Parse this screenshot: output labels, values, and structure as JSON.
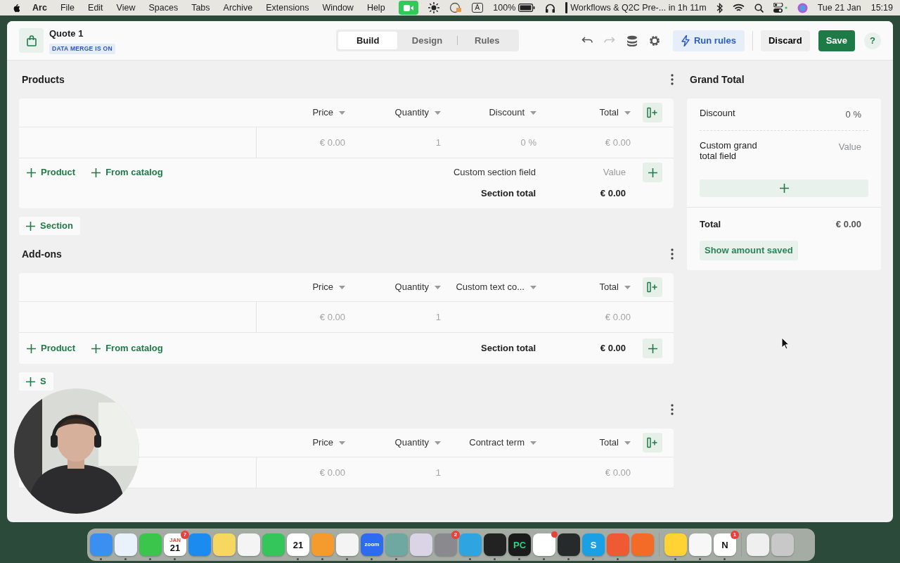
{
  "menu_bar": {
    "app": "Arc",
    "menus": [
      "File",
      "Edit",
      "View",
      "Spaces",
      "Tabs",
      "Archive",
      "Extensions",
      "Window",
      "Help"
    ],
    "input_source": "A",
    "battery": "100%",
    "event": "Workflows & Q2C Pre-... in 1h 11m",
    "date": "Tue 21 Jan",
    "time": "15:19"
  },
  "header": {
    "title": "Quote 1",
    "badge": "DATA MERGE IS ON",
    "tabs": [
      {
        "label": "Build",
        "selected": true
      },
      {
        "label": "Design",
        "selected": false
      },
      {
        "label": "Rules",
        "selected": false
      }
    ],
    "tools": [
      {
        "kind": "undo",
        "disabled": false
      },
      {
        "kind": "redo",
        "disabled": true
      },
      {
        "kind": "database",
        "disabled": false
      },
      {
        "kind": "settings",
        "disabled": false
      }
    ],
    "run_button": "Run rules",
    "discard_button": "Discard",
    "save_button": "Save",
    "help_button": "?"
  },
  "sections": [
    {
      "title": "Products",
      "columns": [
        "Price",
        "Quantity",
        "Discount",
        "Total"
      ],
      "row": {
        "price": "€ 0.00",
        "quantity": "1",
        "column_3": "0 %",
        "total": "€ 0.00"
      },
      "actions": [
        "Product",
        "From catalog"
      ],
      "custom_field": {
        "label": "Custom section field",
        "placeholder": "Value"
      },
      "section_total": {
        "label": "Section total",
        "value": "€ 0.00"
      },
      "add_section": "Section"
    },
    {
      "title": "Add-ons",
      "columns": [
        "Price",
        "Quantity",
        "Custom text co...",
        "Total"
      ],
      "row": {
        "price": "€ 0.00",
        "quantity": "1",
        "total": "€ 0.00"
      },
      "actions": [
        "Product",
        "From catalog"
      ],
      "section_total": {
        "label": "Section total",
        "value": "€ 0.00"
      },
      "add_section": "S"
    },
    {
      "columns": [
        "Price",
        "Quantity",
        "Contract term",
        "Total"
      ],
      "row": {
        "price": "€ 0.00",
        "quantity": "1",
        "total": "€ 0.00"
      }
    }
  ],
  "grand_total": {
    "title": "Grand Total",
    "fields": [
      {
        "label": "Discount",
        "value": "0 %"
      },
      {
        "label": "Custom grand total field",
        "placeholder": "Value"
      }
    ],
    "total": {
      "label": "Total",
      "value": "€ 0.00"
    },
    "show_saved_button": "Show amount saved"
  },
  "dock": {
    "groups": [
      [
        {
          "color": "#3a8ff0",
          "running": true
        },
        {
          "color": "#e9f2fb",
          "running": true
        },
        {
          "color": "#3cc54d",
          "running": true
        },
        {
          "color": "#ffffff",
          "running": true,
          "top_label": "JAN",
          "label": "21",
          "badge": "7"
        },
        {
          "color": "#1c8bf0",
          "running": false
        },
        {
          "color": "#f6d860",
          "running": false
        },
        {
          "color": "#f4f4f4",
          "running": false
        },
        {
          "color": "#34c65a",
          "running": false
        },
        {
          "color": "#ffffff",
          "running": true,
          "label": "21"
        },
        {
          "color": "#f59a2c",
          "running": true
        },
        {
          "color": "#f4f4f4",
          "running": true
        },
        {
          "color": "#2d6cf0",
          "running": true,
          "label": "zoom"
        },
        {
          "color": "#6fa8a0",
          "running": true
        },
        {
          "color": "#d9d4e6",
          "running": false
        },
        {
          "color": "#8a8a8e",
          "running": false,
          "badge": "2"
        },
        {
          "color": "#2ea5e0",
          "running": true
        },
        {
          "color": "#222222",
          "running": true
        },
        {
          "color": "#1b1b1b",
          "running": true,
          "label": "PC"
        },
        {
          "color": "#ffffff",
          "running": true,
          "dot": true
        },
        {
          "color": "#262a2a",
          "running": true
        },
        {
          "color": "#1ba0e3",
          "running": true,
          "label": "S"
        },
        {
          "color": "#ef5a34",
          "running": true
        },
        {
          "color": "#f36b26",
          "running": false
        }
      ],
      [
        {
          "color": "#ffd333",
          "running": true
        },
        {
          "color": "#f7f7f7",
          "running": true
        },
        {
          "color": "#ffffff",
          "running": true,
          "label": "N",
          "badge": "1"
        }
      ],
      [
        {
          "color": "#efefef",
          "running": false
        },
        {
          "color": "#c8c8c8",
          "running": false
        }
      ]
    ]
  }
}
